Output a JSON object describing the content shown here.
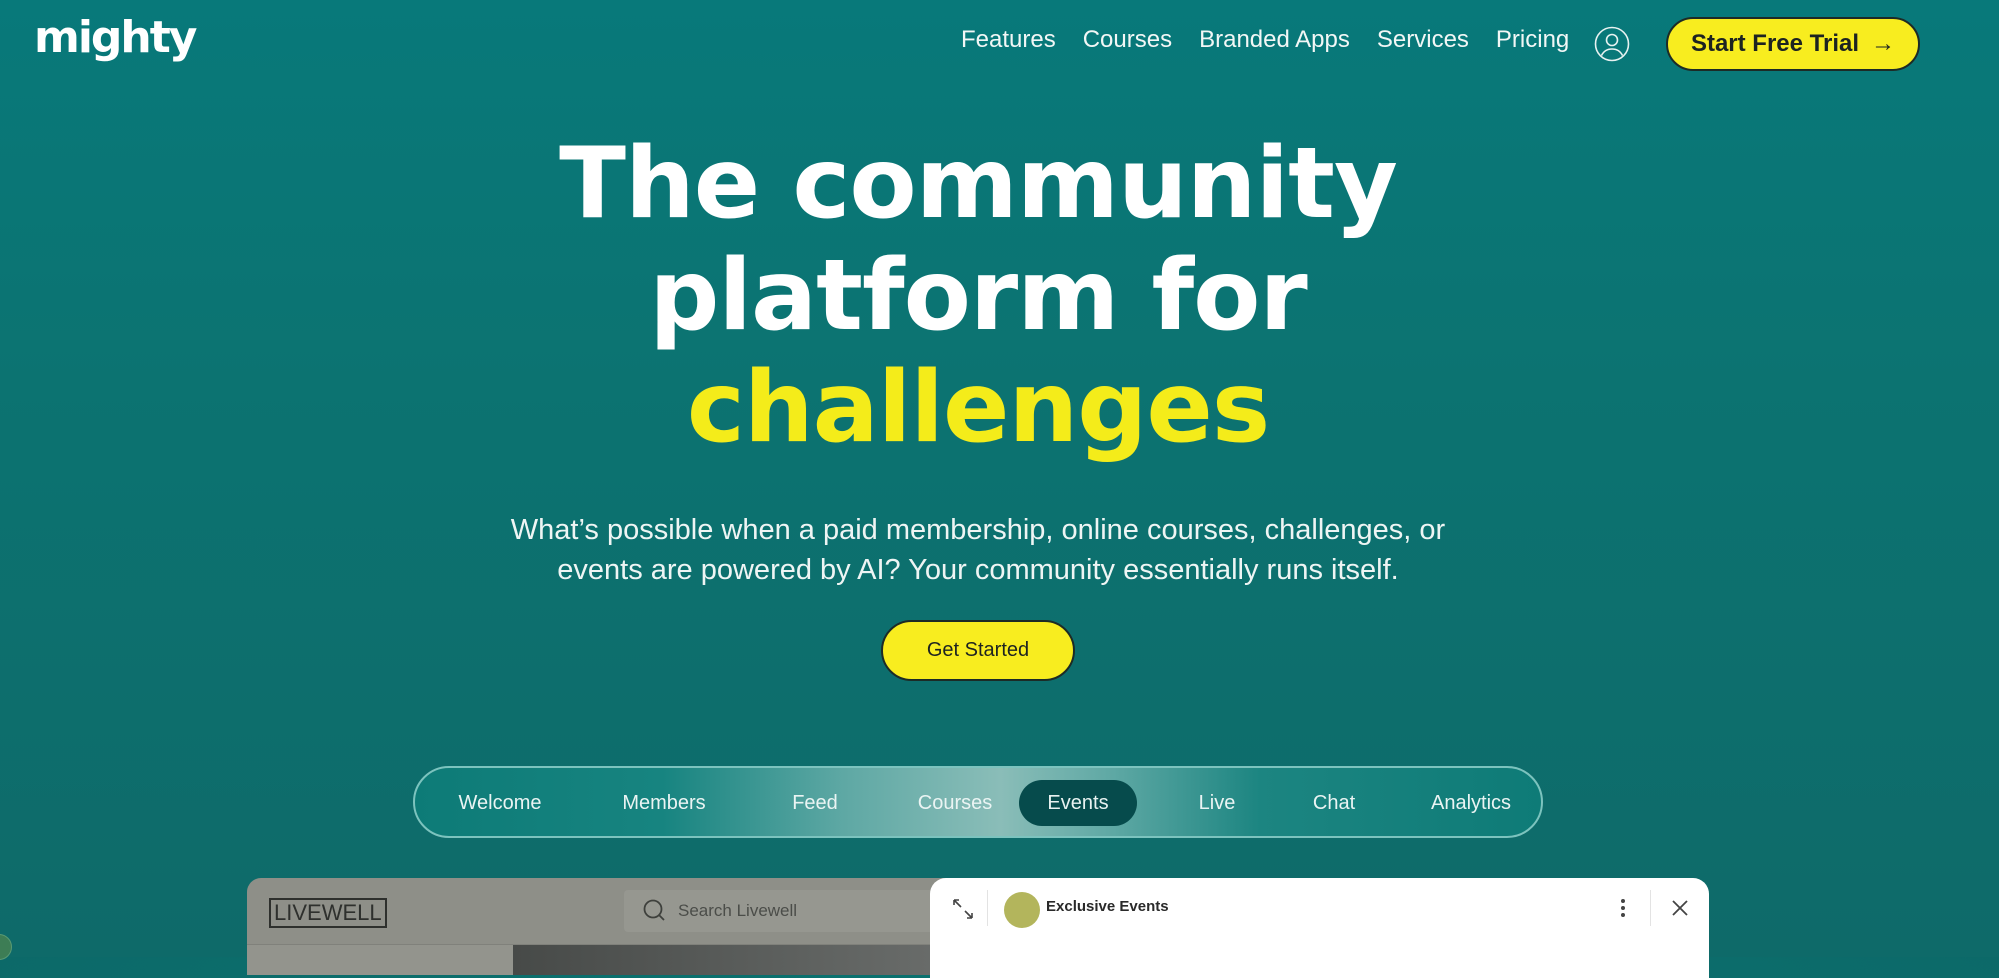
{
  "brand": {
    "logo_text": "mighty"
  },
  "nav": {
    "links": [
      {
        "label": "Features"
      },
      {
        "label": "Courses"
      },
      {
        "label": "Branded Apps"
      },
      {
        "label": "Services"
      },
      {
        "label": "Pricing"
      }
    ],
    "account_icon": "user-circle-icon",
    "cta_label": "Start Free Trial",
    "cta_icon": "arrow-right-icon"
  },
  "hero": {
    "headline_line1": "The community",
    "headline_line2": "platform for",
    "headline_accent": "challenges",
    "subtitle_line1": "What’s possible when a paid membership, online courses, challenges, or",
    "subtitle_line2": "events are powered by AI? Your community essentially runs itself.",
    "cta_label": "Get Started"
  },
  "colors": {
    "background": "#0b7370",
    "accent_yellow": "#f8ed1f",
    "active_tab": "#064b4c"
  },
  "feature_tabs": {
    "items": [
      {
        "label": "Welcome",
        "active": false
      },
      {
        "label": "Members",
        "active": false
      },
      {
        "label": "Feed",
        "active": false
      },
      {
        "label": "Courses",
        "active": false
      },
      {
        "label": "Events",
        "active": true
      },
      {
        "label": "Live",
        "active": false
      },
      {
        "label": "Chat",
        "active": false
      },
      {
        "label": "Analytics",
        "active": false
      }
    ]
  },
  "preview": {
    "app_brand": "LIVEWELL",
    "search_placeholder": "Search Livewell",
    "modal": {
      "title": "Exclusive Events",
      "expand_icon": "expand-icon",
      "menu_icon": "more-vertical-icon",
      "close_icon": "close-icon"
    }
  }
}
